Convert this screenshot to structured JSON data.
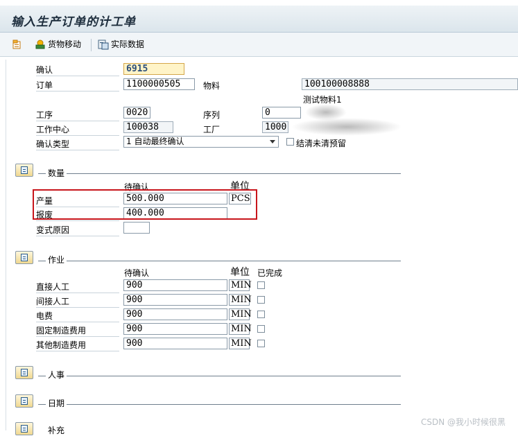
{
  "window": {
    "title": "输入生产订单的计工单"
  },
  "toolbar": {
    "goods_movement_label": "货物移动",
    "actual_data_label": "实际数据"
  },
  "header": {
    "confirmation_label": "确认",
    "confirmation_value": "6915",
    "order_label": "订单",
    "order_value": "1100000505",
    "material_label": "物料",
    "material_value": "100100008888",
    "material_desc": "测试物料1",
    "operation_label": "工序",
    "operation_value": "0020",
    "sequence_label": "序列",
    "sequence_value": "0",
    "workcenter_label": "工作中心",
    "workcenter_value": "100038",
    "plant_label": "工厂",
    "plant_value": "1000",
    "conftype_label": "确认类型",
    "conftype_value": "1 自动最终确认",
    "clear_open_label": "结清未清预留"
  },
  "quantities": {
    "title": "数量",
    "col_to_confirm": "待确认",
    "col_unit": "单位",
    "yield_label": "产量",
    "yield_value": "500.000",
    "yield_unit": "PCS",
    "scrap_label": "报废",
    "scrap_value": "400.000",
    "variance_label": "变式原因",
    "variance_value": ""
  },
  "activities": {
    "title": "作业",
    "col_to_confirm": "待确认",
    "col_unit": "单位",
    "col_done": "已完成",
    "rows": [
      {
        "label": "直接人工",
        "value": "900",
        "unit": "MIN",
        "done": false
      },
      {
        "label": "间接人工",
        "value": "900",
        "unit": "MIN",
        "done": false
      },
      {
        "label": "电费",
        "value": "900",
        "unit": "MIN",
        "done": false
      },
      {
        "label": "固定制造费用",
        "value": "900",
        "unit": "MIN",
        "done": false
      },
      {
        "label": "其他制造费用",
        "value": "900",
        "unit": "MIN",
        "done": false
      }
    ]
  },
  "sections": {
    "personnel": "人事",
    "dates": "日期",
    "supplement": "补充"
  },
  "watermark": "CSDN @我小时候很黑",
  "colors": {
    "highlight": "#c8151b",
    "title_bg": "#dbe5ec",
    "focus_field": "#fff4c8"
  }
}
